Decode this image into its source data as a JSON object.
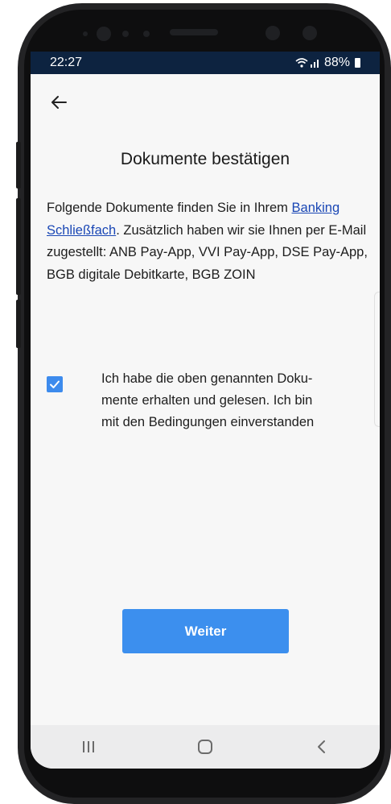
{
  "status_bar": {
    "time": "22:27",
    "battery": "88%",
    "icons": [
      "wifi-icon",
      "signal-icon",
      "battery-icon"
    ]
  },
  "header": {
    "back_icon": "arrow-left-icon",
    "title": "Dokumente bestätigen"
  },
  "body": {
    "text_before_link": "Folgende Dokumente finden Sie in Ihrem ",
    "link_label": "Banking Schließfach",
    "text_after_link": ". Zusätzlich haben wir sie Ihnen per E-Mail zugestellt: ANB Pay-App, VVI Pay-App, DSE Pay-App, BGB digitale Debitkarte, BGB ZOIN"
  },
  "consent": {
    "checked": true,
    "lines": [
      "Ich habe die oben genannten Doku-",
      "mente erhalten und gelesen. Ich bin",
      "mit den Bedingungen einverstanden"
    ]
  },
  "primary_button": {
    "label": "Weiter"
  },
  "nav_bar": {
    "items": [
      "recent-apps-icon",
      "home-icon",
      "back-chevron-icon"
    ]
  },
  "colors": {
    "accent": "#3c8fee",
    "link": "#1a47b5",
    "status_bar": "#0d2340",
    "screen_bg": "#f7f7f7"
  }
}
